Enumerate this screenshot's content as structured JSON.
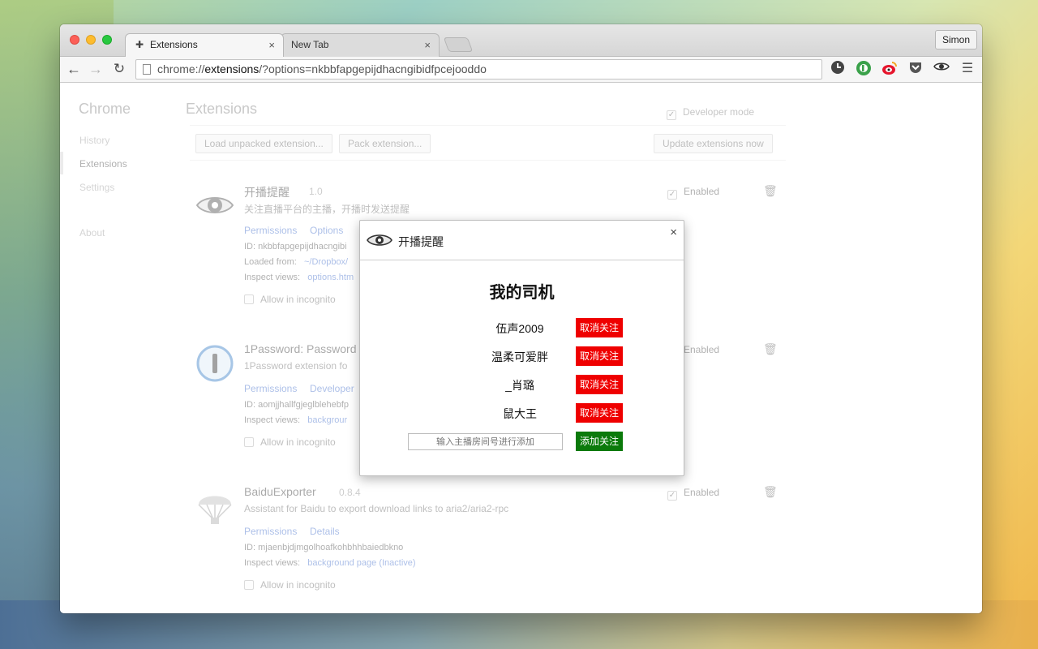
{
  "window": {
    "tabs": [
      {
        "label": "Extensions",
        "close": "×"
      },
      {
        "label": "New Tab",
        "close": "×"
      }
    ],
    "profile": "Simon",
    "url_prefix": "chrome://",
    "url_host": "extensions",
    "url_rest": "/?options=nkbbfapgepijdhacngibidfpcejooddo"
  },
  "sidebar": {
    "title": "Chrome",
    "items": [
      "History",
      "Extensions",
      "Settings",
      "About"
    ]
  },
  "main": {
    "title": "Extensions",
    "developer_mode": "Developer mode",
    "buttons": {
      "load": "Load unpacked extension...",
      "pack": "Pack extension...",
      "update": "Update extensions now"
    },
    "enabled_label": "Enabled",
    "incognito_label": "Allow in incognito",
    "extensions": [
      {
        "name": "开播提醒",
        "version": "1.0",
        "description": "关注直播平台的主播，开播时发送提醒",
        "links": [
          "Permissions",
          "Options"
        ],
        "id_line": "ID: nkbbfapgepijdhacngibi",
        "loaded_label": "Loaded from:",
        "loaded_value": "~/Dropbox/",
        "inspect_label": "Inspect views:",
        "inspect_value": "options.htm"
      },
      {
        "name": "1Password: Password",
        "description": "1Password extension fo",
        "links": [
          "Permissions",
          "Developer"
        ],
        "id_line": "ID: aomjjhallfgjeglblehebfp",
        "inspect_label": "Inspect views:",
        "inspect_value": "backgrour"
      },
      {
        "name": "BaiduExporter",
        "version": "0.8.4",
        "description": "Assistant for Baidu to export download links to aria2/aria2-rpc",
        "links": [
          "Permissions",
          "Details"
        ],
        "id_line": "ID: mjaenbjdjmgolhoafkohbhhbaiedbkno",
        "inspect_label": "Inspect views:",
        "inspect_value": "background page (Inactive)"
      }
    ]
  },
  "dialog": {
    "title": "开播提醒",
    "close": "×",
    "heading": "我的司机",
    "streamers": [
      "伍声2009",
      "温柔可爱胖",
      "_肖璐",
      "鼠大王"
    ],
    "unfollow_label": "取消关注",
    "input_placeholder": "输入主播房间号进行添加",
    "follow_label": "添加关注",
    "colors": {
      "unfollow": "#ef0000",
      "follow": "#0b7a0b"
    }
  }
}
